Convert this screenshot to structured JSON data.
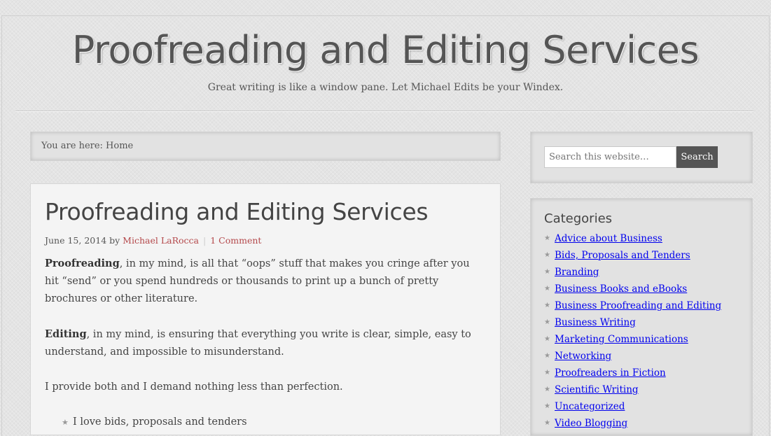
{
  "header": {
    "title": "Proofreading and Editing Services",
    "description": "Great writing is like a window pane. Let Michael Edits be your Windex."
  },
  "breadcrumb": "You are here: Home",
  "post": {
    "title": "Proofreading and Editing Services",
    "date": "June 15, 2014",
    "by": " by ",
    "author": "Michael LaRocca",
    "comments": "1 Comment",
    "p1_bold": "Proofreading",
    "p1_rest": ", in my mind, is all that “oops” stuff that makes you cringe after you hit “send” or you spend hundreds or thousands to print up a bunch of pretty brochures or other literature.",
    "p2_bold": "Editing",
    "p2_rest": ", in my mind, is ensuring that everything you write is clear, simple, easy to understand, and impossible to misunderstand.",
    "p3": "I provide both and I demand nothing less than perfection.",
    "list": [
      "I love bids, proposals and tenders"
    ]
  },
  "search": {
    "placeholder": "Search this website…",
    "button": "Search"
  },
  "categories": {
    "title": "Categories",
    "items": [
      "Advice about Business",
      "Bids, Proposals and Tenders",
      "Branding",
      "Business Books and eBooks",
      "Business Proofreading and Editing",
      "Business Writing",
      "Marketing Communications",
      "Networking",
      "Proofreaders in Fiction",
      "Scientific Writing",
      "Uncategorized",
      "Video Blogging"
    ]
  },
  "colors": {
    "link": "#b4484b",
    "button": "#555555"
  }
}
